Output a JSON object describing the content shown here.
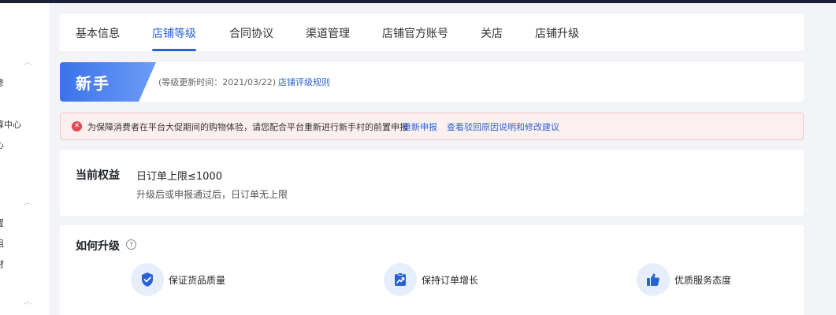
{
  "sidebar": {
    "items": [
      "修",
      "算中心",
      "心",
      "置",
      "组",
      "材"
    ]
  },
  "tabs": [
    {
      "label": "基本信息"
    },
    {
      "label": "店铺等级"
    },
    {
      "label": "合同协议"
    },
    {
      "label": "渠道管理"
    },
    {
      "label": "店铺官方账号"
    },
    {
      "label": "关店"
    },
    {
      "label": "店铺升级"
    }
  ],
  "level": {
    "name": "新手",
    "update_time": "(等级更新时间：2021/03/22)",
    "rules_link": "店铺评级规则"
  },
  "alert": {
    "message": "为保障消费者在平台大促期间的购物体验，请您配合平台重新进行新手村的前置申报",
    "reapply_link": "重新申报",
    "reason_link": "查看驳回原因说明和修改建议"
  },
  "benefits": {
    "title": "当前权益",
    "line1": "日订单上限≤1000",
    "line2": "升级后或申报通过后，日订单无上限"
  },
  "upgrade": {
    "title": "如何升级",
    "items": [
      {
        "label": "保证货品质量",
        "icon": "shield-check-icon"
      },
      {
        "label": "保持订单增长",
        "icon": "growth-chart-icon"
      },
      {
        "label": "优质服务态度",
        "icon": "thumbs-up-icon"
      }
    ]
  },
  "colors": {
    "accent": "#2a62d6",
    "alert_bg": "#fceff0",
    "alert_icon": "#e8474e"
  }
}
